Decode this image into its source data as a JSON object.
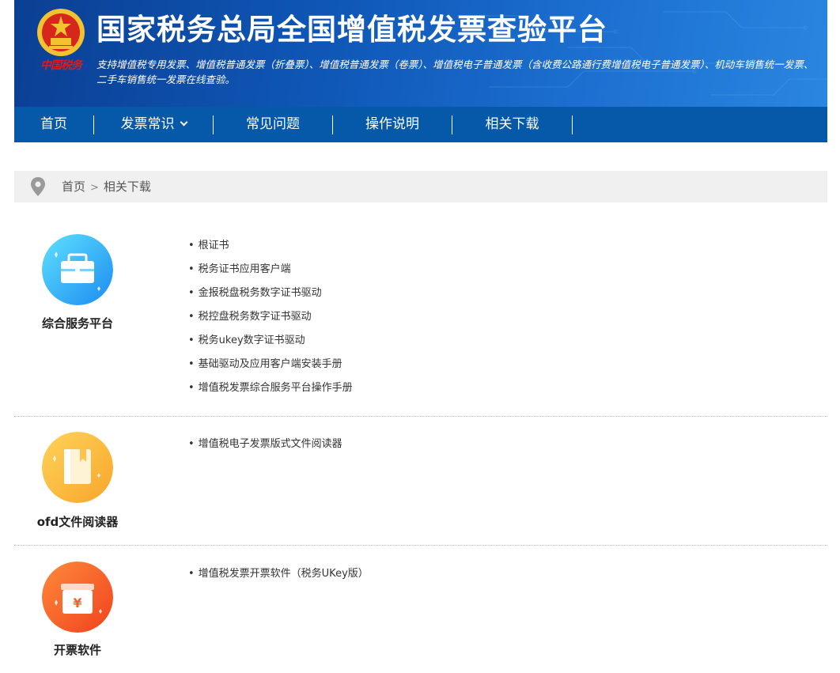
{
  "header": {
    "logo_text": "中国税务",
    "title": "国家税务总局全国增值税发票查验平台",
    "subtitle": "支持增值税专用发票、增值税普通发票（折叠票）、增值税普通发票（卷票）、增值税电子普通发票（含收费公路通行费增值税电子普通发票）、机动车销售统一发票、二手车销售统一发票在线查验。"
  },
  "nav": {
    "items": [
      {
        "label": "首页"
      },
      {
        "label": "发票常识"
      },
      {
        "label": "常见问题"
      },
      {
        "label": "操作说明"
      },
      {
        "label": "相关下载"
      }
    ]
  },
  "breadcrumb": {
    "home": "首页",
    "separator": ">",
    "current": "相关下载"
  },
  "sections": [
    {
      "title": "综合服务平台",
      "icon": "briefcase-icon",
      "color": "#2fb3f5",
      "links": [
        "根证书",
        "税务证书应用客户端",
        "金报税盘税务数字证书驱动",
        "税控盘税务数字证书驱动",
        "税务ukey数字证书驱动",
        "基础驱动及应用客户端安装手册",
        "增值税发票综合服务平台操作手册"
      ]
    },
    {
      "title": "ofd文件阅读器",
      "icon": "book-icon",
      "color": "#fbb53a",
      "links": [
        "增值税电子发票版式文件阅读器"
      ]
    },
    {
      "title": "开票软件",
      "icon": "invoice-box-icon",
      "color": "#fa6a34",
      "links": [
        "增值税发票开票软件（税务UKey版）"
      ]
    }
  ],
  "colors": {
    "banner_blue": "#0f58b8",
    "nav_blue": "#0659a8",
    "breadcrumb_bg": "#f0f0f0"
  }
}
